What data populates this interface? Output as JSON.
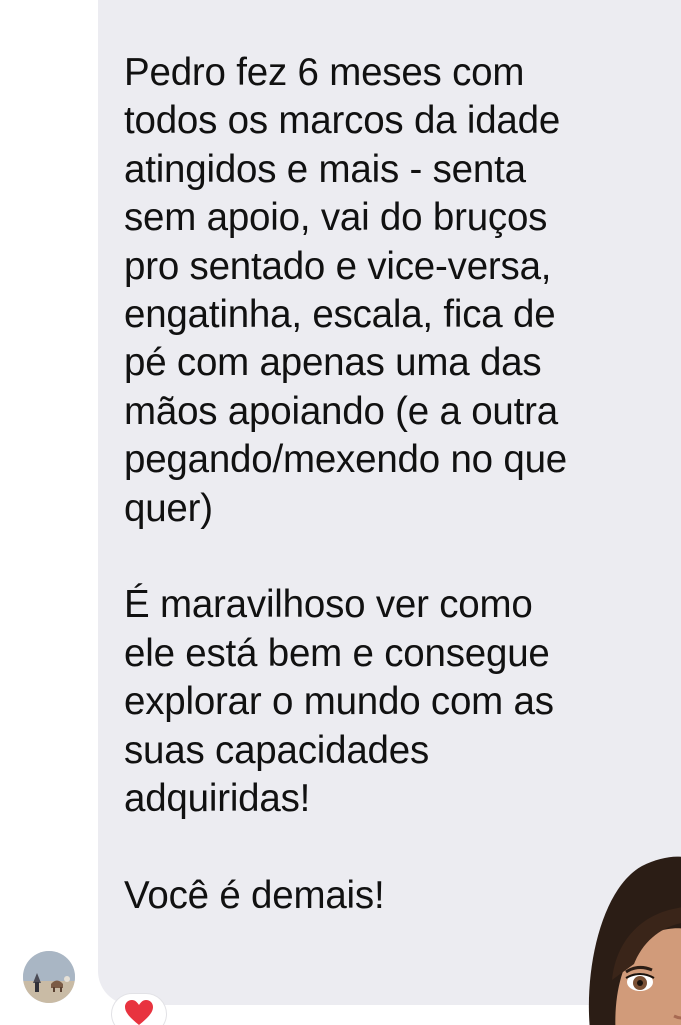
{
  "message": {
    "paragraphs": [
      "Pedro fez 6 meses com\ntodos os marcos da idade\natingidos e mais - senta\nsem apoio, vai do bruços\npro sentado e vice-versa,\nengatinha, escala, fica de\npé com apenas uma das\nmãos apoiando (e a outra\npegando/mexendo no que\nquer)",
      "É maravilhoso ver como\nele está bem e consegue\nexplorar o mundo com as\nsuas capacidades\nadquiridas!",
      "Você é demais!"
    ]
  },
  "colors": {
    "bubble": "#ececf1",
    "text": "#111111",
    "accent_strip": "#8ecdf3",
    "reaction_heart": "#e8333f"
  },
  "icons": {
    "avatar": "sender-avatar",
    "reaction": "heart-icon",
    "sticker": "bitmoji-sticker"
  }
}
